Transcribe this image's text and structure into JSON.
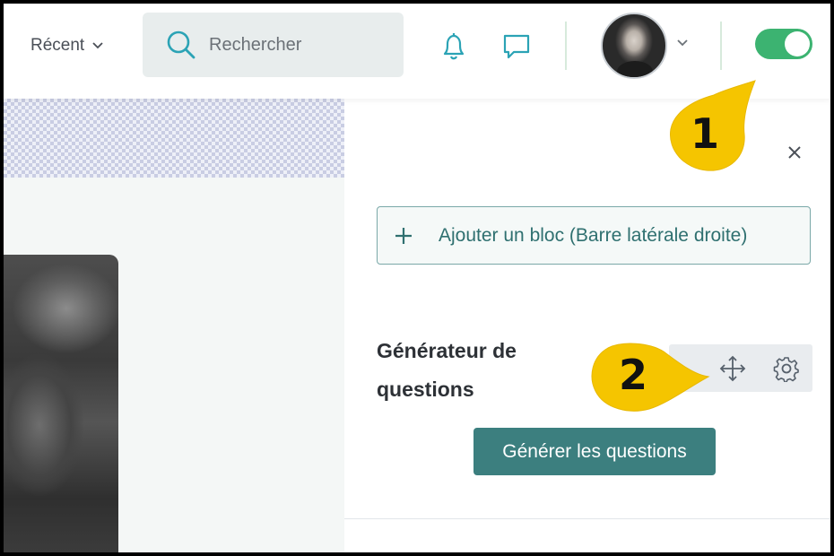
{
  "header": {
    "recent_label": "Récent",
    "search_placeholder": "Rechercher"
  },
  "icons": {
    "search": "search-icon",
    "notifications": "bell-icon",
    "messages": "chat-bubble-icon",
    "profile_menu": "chevron-down-icon",
    "close": "close-icon",
    "add": "plus-icon",
    "move": "move-arrows-icon",
    "settings": "gear-icon"
  },
  "edit_mode_toggle": {
    "on": true
  },
  "sidebar": {
    "add_block_label": "Ajouter un bloc (Barre latérale droite)",
    "block": {
      "title_line1": "Générateur de",
      "title_line2": "questions",
      "button_label": "Générer les questions"
    }
  },
  "callouts": [
    {
      "number": "1"
    },
    {
      "number": "2"
    }
  ],
  "colors": {
    "accent": "#3c7f7f",
    "icon_teal": "#2ba3b5",
    "toggle_on": "#3cb371",
    "callout_yellow": "#f5c500"
  }
}
